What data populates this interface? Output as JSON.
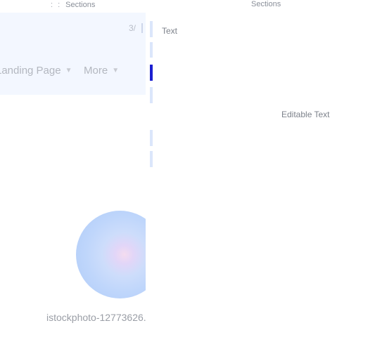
{
  "left": {
    "breadcrumb": {
      "dots": ": :",
      "label": "Sections"
    },
    "nav": {
      "icon_a": "3/",
      "items": [
        {
          "label": "Landing Page",
          "icon": "chevron-down-icon"
        },
        {
          "label": "More",
          "icon": "chevron-down-icon"
        }
      ]
    },
    "image_caption": "istockphoto-12773626..."
  },
  "right": {
    "breadcrumb": "Sections",
    "text_label": "Text",
    "editable_text": "Editable Text"
  },
  "colors": {
    "nav_bg": "#f3f7ff",
    "accent": "#1b1fd0",
    "guide": "#dbe6fb"
  }
}
